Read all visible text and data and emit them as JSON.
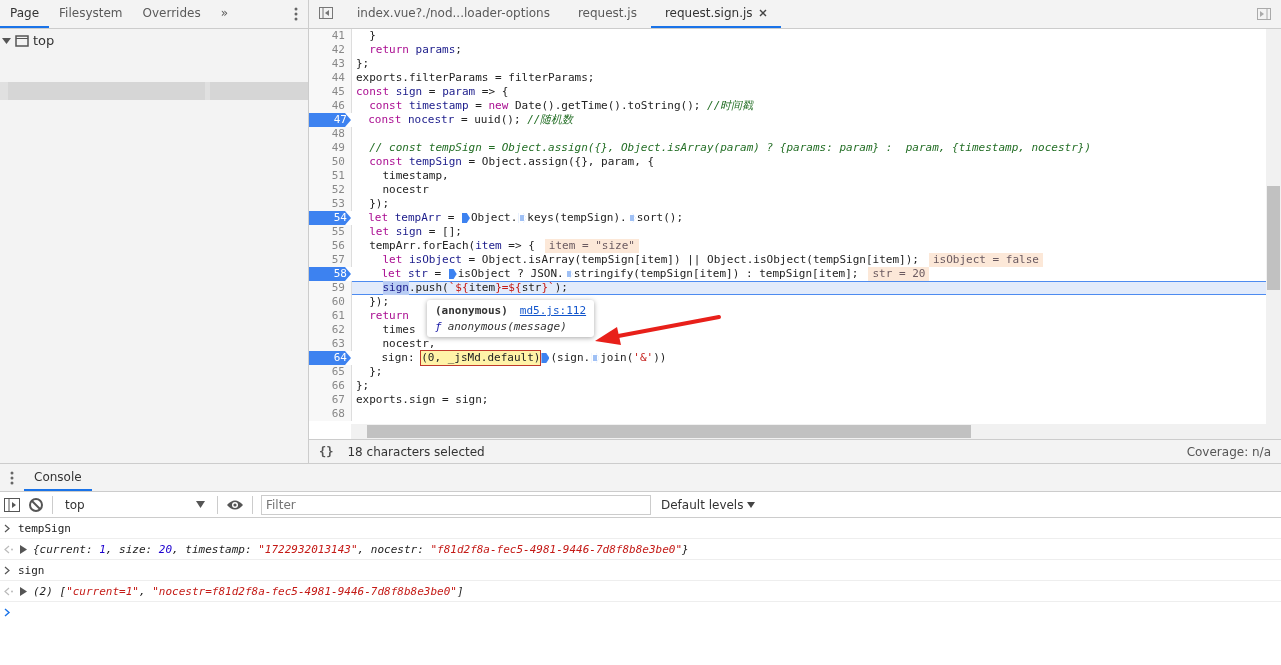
{
  "navigator": {
    "tabs": [
      {
        "label": "Page",
        "selected": true
      },
      {
        "label": "Filesystem",
        "selected": false
      },
      {
        "label": "Overrides",
        "selected": false
      }
    ],
    "more": "»",
    "tree": [
      {
        "label": "top",
        "expanded": true
      }
    ]
  },
  "editor": {
    "tabs": [
      {
        "label": "index.vue?./nod...loader-options",
        "selected": false,
        "closable": false
      },
      {
        "label": "request.js",
        "selected": false,
        "closable": false
      },
      {
        "label": "request.sign.js",
        "selected": true,
        "closable": true
      }
    ],
    "lines": [
      {
        "number": "41",
        "breakpoint": false,
        "current": false,
        "tokens": [
          {
            "kind": "plain",
            "text": "  }"
          }
        ]
      },
      {
        "number": "42",
        "breakpoint": false,
        "current": false,
        "tokens": [
          {
            "kind": "keyword",
            "text": "  return"
          },
          {
            "kind": "def",
            "text": " params"
          },
          {
            "kind": "plain",
            "text": ";"
          }
        ]
      },
      {
        "number": "43",
        "breakpoint": false,
        "current": false,
        "tokens": [
          {
            "kind": "plain",
            "text": "};"
          }
        ]
      },
      {
        "number": "44",
        "breakpoint": false,
        "current": false,
        "tokens": [
          {
            "kind": "plain",
            "text": "exports.filterParams = filterParams;"
          }
        ]
      },
      {
        "number": "45",
        "breakpoint": false,
        "current": false,
        "tokens": [
          {
            "kind": "keyword",
            "text": "const"
          },
          {
            "kind": "def",
            "text": " sign"
          },
          {
            "kind": "plain",
            "text": " = "
          },
          {
            "kind": "def",
            "text": "param"
          },
          {
            "kind": "plain",
            "text": " => {"
          }
        ]
      },
      {
        "number": "46",
        "breakpoint": false,
        "current": false,
        "tokens": [
          {
            "kind": "keyword",
            "text": "  const"
          },
          {
            "kind": "def",
            "text": " timestamp"
          },
          {
            "kind": "plain",
            "text": " = "
          },
          {
            "kind": "keyword",
            "text": "new"
          },
          {
            "kind": "plain",
            "text": " Date().getTime().toString(); "
          },
          {
            "kind": "comment",
            "text": "//时间戳"
          }
        ]
      },
      {
        "number": "47",
        "breakpoint": true,
        "current": false,
        "tokens": [
          {
            "kind": "keyword",
            "text": "  const"
          },
          {
            "kind": "def",
            "text": " nocestr"
          },
          {
            "kind": "plain",
            "text": " = uuid(); "
          },
          {
            "kind": "comment",
            "text": "//随机数"
          }
        ]
      },
      {
        "number": "48",
        "breakpoint": false,
        "current": false
      },
      {
        "number": "49",
        "breakpoint": false,
        "current": false,
        "tokens": [
          {
            "kind": "comment",
            "text": "  // const tempSign = Object.assign({}, Object.isArray(param) ? {params: param} :  param, {timestamp, nocestr})"
          }
        ]
      },
      {
        "number": "50",
        "breakpoint": false,
        "current": false,
        "tokens": [
          {
            "kind": "keyword",
            "text": "  const"
          },
          {
            "kind": "def",
            "text": " tempSign"
          },
          {
            "kind": "plain",
            "text": " = Object.assign({}, param, {"
          }
        ]
      },
      {
        "number": "51",
        "breakpoint": false,
        "current": false,
        "tokens": [
          {
            "kind": "plain",
            "text": "    timestamp,"
          }
        ]
      },
      {
        "number": "52",
        "breakpoint": false,
        "current": false,
        "tokens": [
          {
            "kind": "plain",
            "text": "    nocestr"
          }
        ]
      },
      {
        "number": "53",
        "breakpoint": false,
        "current": false,
        "tokens": [
          {
            "kind": "plain",
            "text": "  });"
          }
        ]
      },
      {
        "number": "54",
        "breakpoint": true,
        "current": false,
        "tokens": [
          {
            "kind": "keyword",
            "text": "  let"
          },
          {
            "kind": "def",
            "text": " tempArr"
          },
          {
            "kind": "plain",
            "text": " = "
          },
          {
            "kind": "marker",
            "active": true
          },
          {
            "kind": "plain",
            "text": "Object."
          },
          {
            "kind": "marker",
            "active": false
          },
          {
            "kind": "plain",
            "text": "keys(tempSign)."
          },
          {
            "kind": "marker",
            "active": false
          },
          {
            "kind": "plain",
            "text": "sort();"
          }
        ]
      },
      {
        "number": "55",
        "breakpoint": false,
        "current": false,
        "tokens": [
          {
            "kind": "keyword",
            "text": "  let"
          },
          {
            "kind": "def",
            "text": " sign"
          },
          {
            "kind": "plain",
            "text": " = [];"
          }
        ]
      },
      {
        "number": "56",
        "breakpoint": false,
        "current": false,
        "tokens": [
          {
            "kind": "plain",
            "text": "  tempArr.forEach("
          },
          {
            "kind": "def",
            "text": "item"
          },
          {
            "kind": "plain",
            "text": " => {"
          }
        ],
        "inline_value": "item = \"size\""
      },
      {
        "number": "57",
        "breakpoint": false,
        "current": false,
        "tokens": [
          {
            "kind": "keyword",
            "text": "    let"
          },
          {
            "kind": "def",
            "text": " isObject"
          },
          {
            "kind": "plain",
            "text": " = Object.isArray(tempSign[item]) || Object.isObject(tempSign[item]);"
          }
        ],
        "inline_value": "isObject = false"
      },
      {
        "number": "58",
        "breakpoint": true,
        "current": false,
        "tokens": [
          {
            "kind": "keyword",
            "text": "    let"
          },
          {
            "kind": "def",
            "text": " str"
          },
          {
            "kind": "plain",
            "text": " = "
          },
          {
            "kind": "marker",
            "active": true
          },
          {
            "kind": "plain",
            "text": "isObject ? JSON."
          },
          {
            "kind": "marker",
            "active": false
          },
          {
            "kind": "plain",
            "text": "stringify(tempSign[item]) : tempSign[item];"
          }
        ],
        "inline_value": "str = 20"
      },
      {
        "number": "59",
        "breakpoint": false,
        "current": true,
        "tokens": [
          {
            "kind": "selection",
            "text": "    sign"
          },
          {
            "kind": "plain",
            "text": ".push("
          },
          {
            "kind": "string",
            "text": "`${"
          },
          {
            "kind": "plain",
            "text": "item"
          },
          {
            "kind": "string",
            "text": "}=${"
          },
          {
            "kind": "plain",
            "text": "str"
          },
          {
            "kind": "string",
            "text": "}`"
          },
          {
            "kind": "plain",
            "text": ");"
          }
        ]
      },
      {
        "number": "60",
        "breakpoint": false,
        "current": false,
        "tokens": [
          {
            "kind": "plain",
            "text": "  });"
          }
        ]
      },
      {
        "number": "61",
        "breakpoint": false,
        "current": false,
        "tokens": [
          {
            "kind": "keyword",
            "text": "  return"
          }
        ]
      },
      {
        "number": "62",
        "breakpoint": false,
        "current": false,
        "tokens": [
          {
            "kind": "plain",
            "text": "    times"
          }
        ]
      },
      {
        "number": "63",
        "breakpoint": false,
        "current": false,
        "tokens": [
          {
            "kind": "plain",
            "text": "    nocestr,"
          }
        ]
      },
      {
        "number": "64",
        "breakpoint": true,
        "current": false,
        "tokens": [
          {
            "kind": "plain",
            "text": "    sign: "
          },
          {
            "kind": "evaluated",
            "text": "(0, _jsMd.default)"
          },
          {
            "kind": "marker",
            "active": true
          },
          {
            "kind": "plain",
            "text": "(sign."
          },
          {
            "kind": "marker",
            "active": false
          },
          {
            "kind": "plain",
            "text": "join("
          },
          {
            "kind": "string",
            "text": "'&'"
          },
          {
            "kind": "plain",
            "text": "))"
          }
        ]
      },
      {
        "number": "65",
        "breakpoint": false,
        "current": false,
        "tokens": [
          {
            "kind": "plain",
            "text": "  };"
          }
        ]
      },
      {
        "number": "66",
        "breakpoint": false,
        "current": false,
        "tokens": [
          {
            "kind": "plain",
            "text": "};"
          }
        ]
      },
      {
        "number": "67",
        "breakpoint": false,
        "current": false,
        "tokens": [
          {
            "kind": "plain",
            "text": "exports.sign = sign;"
          }
        ]
      },
      {
        "number": "68",
        "breakpoint": false,
        "current": false
      }
    ],
    "popover": {
      "title": "(anonymous)",
      "link": "md5.js:112",
      "glyph": "ƒ",
      "signature": "anonymous(message)"
    },
    "status": {
      "format": "{}",
      "selection": "18 characters selected",
      "coverage": "Coverage: n/a"
    }
  },
  "drawer": {
    "tabs": [
      {
        "label": "Console",
        "selected": true
      }
    ],
    "toolbar": {
      "context": "top",
      "filter_placeholder": "Filter",
      "levels": "Default levels"
    },
    "entries": [
      {
        "kind": "input",
        "tokens": [
          {
            "kind": "plain",
            "text": "tempSign"
          }
        ]
      },
      {
        "kind": "output",
        "tokens": [
          {
            "kind": "plain",
            "text": "{current: "
          },
          {
            "kind": "number",
            "text": "1"
          },
          {
            "kind": "plain",
            "text": ", size: "
          },
          {
            "kind": "number",
            "text": "20"
          },
          {
            "kind": "plain",
            "text": ", timestamp: "
          },
          {
            "kind": "string",
            "text": "\"1722932013143\""
          },
          {
            "kind": "plain",
            "text": ", nocestr: "
          },
          {
            "kind": "string",
            "text": "\"f81d2f8a-fec5-4981-9446-7d8f8b8e3be0\""
          },
          {
            "kind": "plain",
            "text": "}"
          }
        ]
      },
      {
        "kind": "input",
        "tokens": [
          {
            "kind": "plain",
            "text": "sign"
          }
        ]
      },
      {
        "kind": "output",
        "tokens": [
          {
            "kind": "plain",
            "text": "(2) ["
          },
          {
            "kind": "string",
            "text": "\"current=1\""
          },
          {
            "kind": "plain",
            "text": ", "
          },
          {
            "kind": "string",
            "text": "\"nocestr=f81d2f8a-fec5-4981-9446-7d8f8b8e3be0\""
          },
          {
            "kind": "plain",
            "text": "]"
          }
        ]
      },
      {
        "kind": "prompt"
      }
    ]
  }
}
